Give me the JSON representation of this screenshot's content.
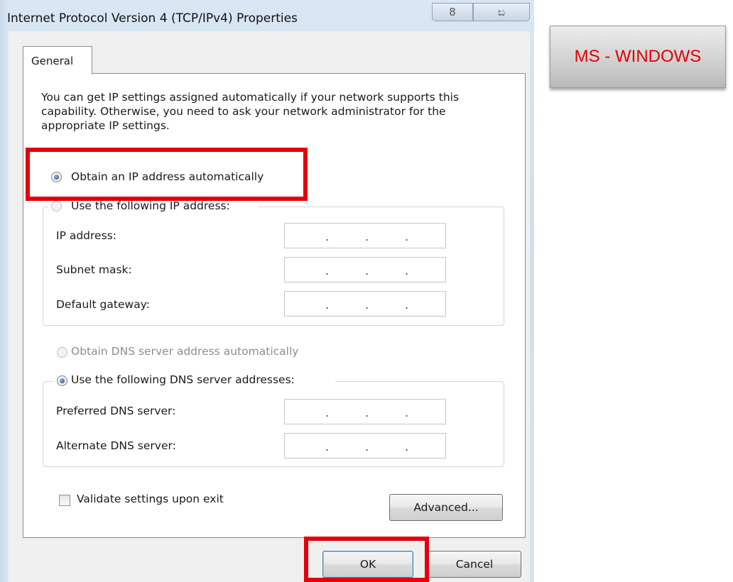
{
  "window": {
    "title": "Internet Protocol Version 4 (TCP/IPv4) Properties",
    "help_glyph": "8",
    "close_glyph": "ಬ"
  },
  "tabs": [
    {
      "label": "General",
      "selected": true
    }
  ],
  "general": {
    "description": "You can get IP settings assigned automatically if your network supports this capability. Otherwise, you need to ask your network administrator for the appropriate IP settings.",
    "ip_mode": {
      "auto_label": "Obtain an IP address automatically",
      "manual_label": "Use the following IP address:",
      "selected": "auto"
    },
    "ip_fields": [
      {
        "label": "IP address:",
        "value": ""
      },
      {
        "label": "Subnet mask:",
        "value": ""
      },
      {
        "label": "Default gateway:",
        "value": ""
      }
    ],
    "dns_mode": {
      "auto_label": "Obtain DNS server address automatically",
      "manual_label": "Use the following DNS server addresses:",
      "selected": "manual"
    },
    "dns_fields": [
      {
        "label": "Preferred DNS server:",
        "value": ""
      },
      {
        "label": "Alternate DNS server:",
        "value": ""
      }
    ],
    "validate_label": "Validate settings upon exit",
    "validate_checked": false,
    "advanced_label": "Advanced..."
  },
  "footer": {
    "ok_label": "OK",
    "cancel_label": "Cancel"
  },
  "annotation": {
    "label": "MS - WINDOWS",
    "color": "#e00000",
    "highlight_color": "#e3000b"
  }
}
